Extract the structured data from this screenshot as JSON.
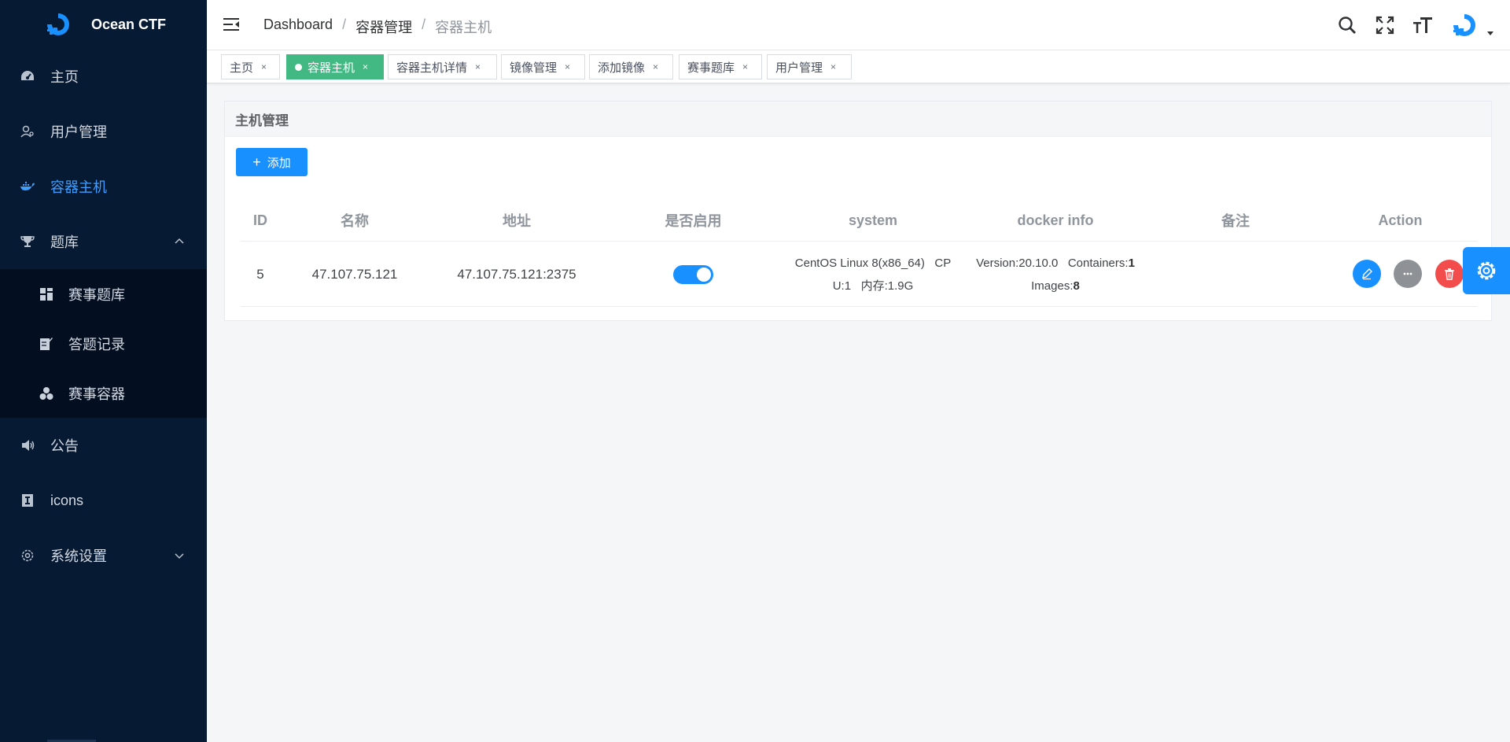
{
  "app": {
    "name": "Ocean CTF"
  },
  "sidebar": {
    "items": [
      {
        "label": "主页",
        "icon": "dashboard-icon"
      },
      {
        "label": "用户管理",
        "icon": "user-icon"
      },
      {
        "label": "容器主机",
        "icon": "docker-icon"
      },
      {
        "label": "题库",
        "icon": "trophy-icon"
      },
      {
        "label": "公告",
        "icon": "speaker-icon"
      },
      {
        "label": "icons",
        "icon": "info-icon"
      },
      {
        "label": "系统设置",
        "icon": "gear-icon"
      }
    ],
    "sub_items": [
      {
        "label": "赛事题库",
        "icon": "grid-icon"
      },
      {
        "label": "答题记录",
        "icon": "edit-doc-icon"
      },
      {
        "label": "赛事容器",
        "icon": "cubes-icon"
      }
    ],
    "active": "容器主机"
  },
  "header": {
    "breadcrumb": [
      "Dashboard",
      "容器管理",
      "容器主机"
    ],
    "separator": "/"
  },
  "tags": [
    {
      "label": "主页",
      "active": false
    },
    {
      "label": "容器主机",
      "active": true
    },
    {
      "label": "容器主机详情",
      "active": false
    },
    {
      "label": "镜像管理",
      "active": false
    },
    {
      "label": "添加镜像",
      "active": false
    },
    {
      "label": "赛事题库",
      "active": false
    },
    {
      "label": "用户管理",
      "active": false
    }
  ],
  "tag_close": "×",
  "card": {
    "title": "主机管理",
    "add_label": "添加",
    "add_symbol": "+"
  },
  "table": {
    "columns": [
      "ID",
      "名称",
      "地址",
      "是否启用",
      "system",
      "docker info",
      "备注",
      "Action"
    ],
    "rows": [
      {
        "id": "5",
        "name": "47.107.75.121",
        "address": "47.107.75.121:2375",
        "enabled": true,
        "system_line1": "CentOS Linux 8(x86_64)   CP",
        "system_line2": "U:1   内存:1.9G",
        "docker_version_label": "Version:",
        "docker_version": "20.10.0",
        "docker_containers_label": "Containers:",
        "docker_containers": "1",
        "docker_images_label": "Images:",
        "docker_images": "8",
        "remark": ""
      }
    ]
  },
  "colors": {
    "sidebar_bg": "#071a33",
    "accent": "#1890ff",
    "active_tag": "#42b983",
    "danger": "#f34c4c",
    "more": "#8e9297"
  }
}
